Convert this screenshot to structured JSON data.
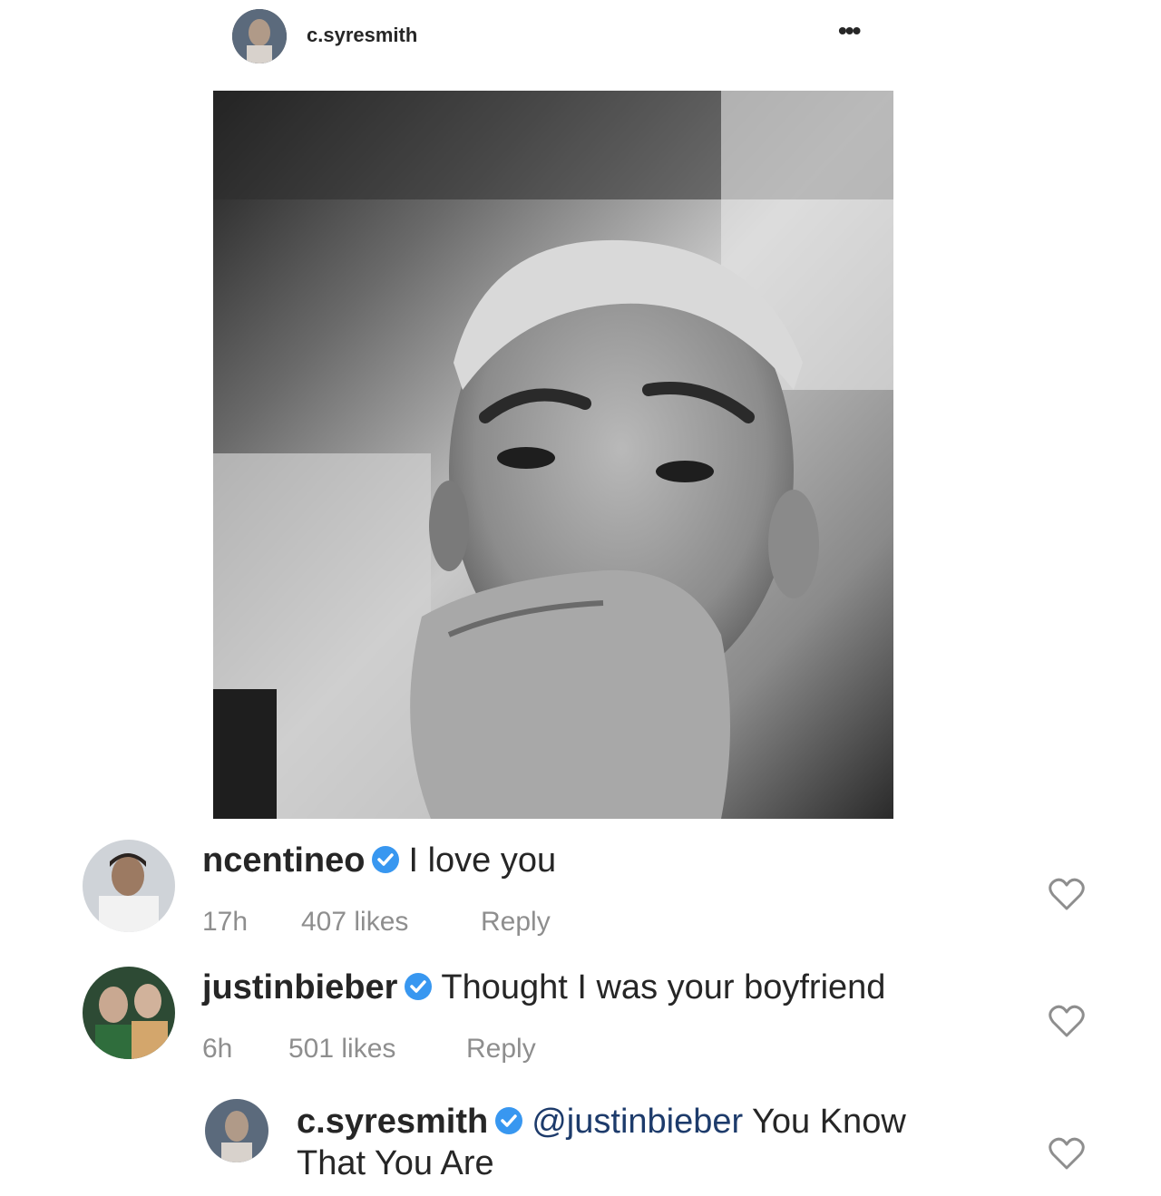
{
  "post": {
    "username": "c.syresmith",
    "more_label": "•••"
  },
  "comments": [
    {
      "username": "ncentineo",
      "text": "I love you",
      "time": "17h",
      "likes": "407 likes",
      "reply": "Reply"
    },
    {
      "username": "justinbieber",
      "text": "Thought I was your boyfriend",
      "time": "6h",
      "likes": "501 likes",
      "reply": "Reply"
    }
  ],
  "reply_comment": {
    "username": "c.syresmith",
    "mention": "@justinbieber",
    "text_line1": "You Know",
    "text_line2": "That You Are"
  },
  "colors": {
    "verified": "#3897f0",
    "mention": "#1d3b6b",
    "meta": "#8e8e8e"
  }
}
